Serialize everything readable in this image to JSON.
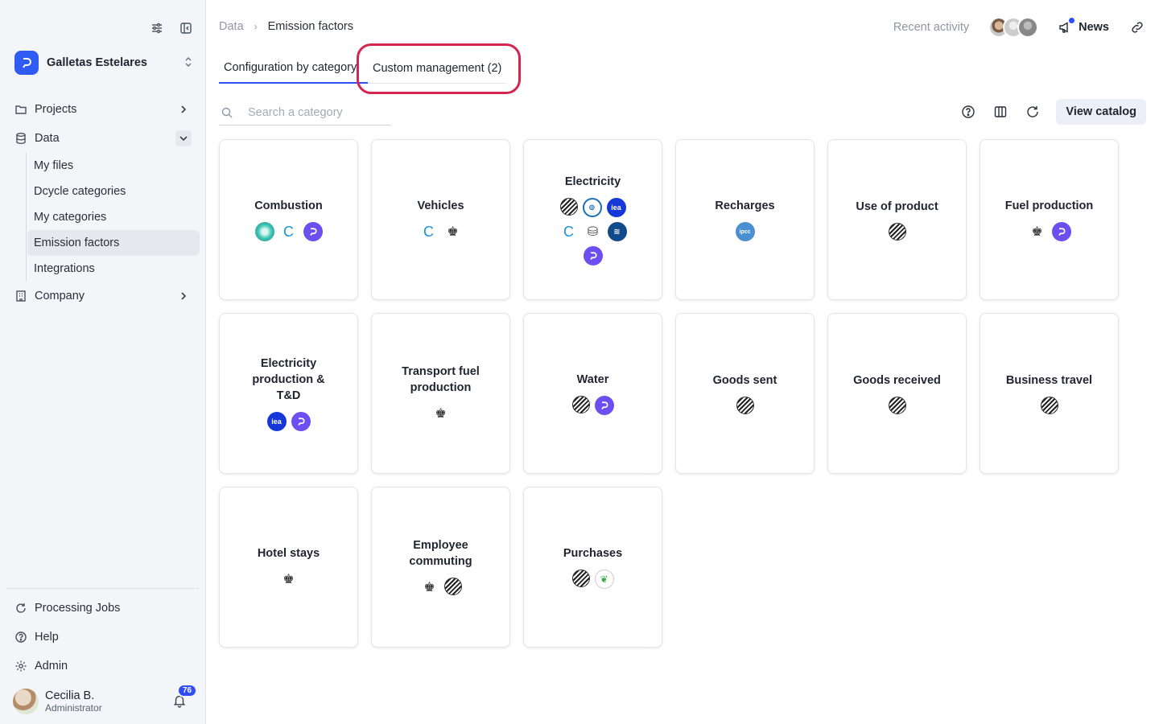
{
  "org": {
    "name": "Galletas Estelares"
  },
  "nav": {
    "projects": "Projects",
    "data": "Data",
    "data_sub": [
      "My files",
      "Dcycle categories",
      "My categories",
      "Emission factors",
      "Integrations"
    ],
    "company": "Company",
    "processing_jobs": "Processing Jobs",
    "help": "Help",
    "admin": "Admin"
  },
  "user": {
    "name": "Cecilia B.",
    "role": "Administrator",
    "notifications": "76"
  },
  "breadcrumb": {
    "root": "Data",
    "current": "Emission factors"
  },
  "topbar": {
    "recent_activity": "Recent activity",
    "news": "News"
  },
  "tabs": {
    "config": "Configuration by category",
    "custom": "Custom management (2)"
  },
  "search": {
    "placeholder": "Search a category"
  },
  "toolbar": {
    "view_catalog": "View catalog"
  },
  "cards": [
    {
      "title": "Combustion",
      "logos": [
        "teal",
        "cibse",
        "dcycle"
      ]
    },
    {
      "title": "Vehicles",
      "logos": [
        "cibse",
        "crest"
      ]
    },
    {
      "title": "Electricity",
      "logos": [
        "striped",
        "epa",
        "iea",
        "cibse",
        "db",
        "wave",
        "dcycle"
      ]
    },
    {
      "title": "Recharges",
      "logos": [
        "ipcc"
      ]
    },
    {
      "title": "Use of product",
      "logos": [
        "striped"
      ]
    },
    {
      "title": "Fuel production",
      "logos": [
        "crest",
        "dcycle"
      ]
    },
    {
      "title": "Electricity production & T&D",
      "logos": [
        "iea",
        "dcycle"
      ]
    },
    {
      "title": "Transport fuel production",
      "logos": [
        "crest"
      ]
    },
    {
      "title": "Water",
      "logos": [
        "striped",
        "dcycle"
      ]
    },
    {
      "title": "Goods sent",
      "logos": [
        "striped"
      ]
    },
    {
      "title": "Goods received",
      "logos": [
        "striped"
      ]
    },
    {
      "title": "Business travel",
      "logos": [
        "striped"
      ]
    },
    {
      "title": "Hotel stays",
      "logos": [
        "crest"
      ]
    },
    {
      "title": "Employee commuting",
      "logos": [
        "crest",
        "striped"
      ]
    },
    {
      "title": "Purchases",
      "logos": [
        "striped",
        "leaf"
      ]
    }
  ],
  "logo_text": {
    "iea": "iea",
    "ipcc": "ipcc",
    "cibse": "C",
    "crest": "♚",
    "db": "⛁",
    "wave": "≋",
    "leaf": "❦",
    "epa": "⊚"
  }
}
